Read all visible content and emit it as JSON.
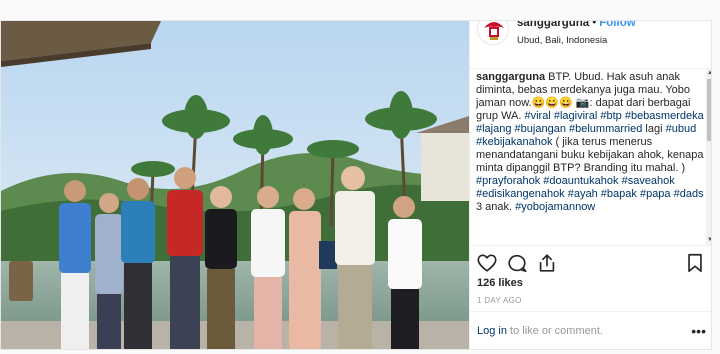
{
  "header": {
    "username": "sanggarguna",
    "separator": "•",
    "follow_label": "Follow",
    "location": "Ubud, Bali, Indonesia"
  },
  "caption": {
    "username": "sanggarguna",
    "text_1": " BTP. Ubud. Hak asuh anak diminta, bebas merdekanya juga mau. Yobo jaman now.",
    "emoji_1": "😀😀😀",
    "camera": "📷",
    "text_2": ": dapat dari berbagai grup WA. ",
    "tags_1": [
      "#viral",
      "#lagiviral",
      "#btp",
      "#bebasmerdeka",
      "#lajang",
      "#bujangan",
      "#belummarried"
    ],
    "text_3": " lagi ",
    "tags_2": [
      "#ubud",
      "#kebijakanahok"
    ],
    "text_4": " ( jika terus menerus menandatangani buku kebijakan ahok, kenapa minta dipanggil BTP? Branding itu mahal. ) ",
    "tags_3": [
      "#prayforahok",
      "#doauntukahok",
      "#saveahok",
      "#edisikangenahok",
      "#ayah",
      "#bapak",
      "#papa",
      "#dads"
    ],
    "text_5": " 3 anak. ",
    "tags_4": [
      "#yobojamannow"
    ]
  },
  "actions": {
    "like_icon": "heart-icon",
    "comment_icon": "comment-icon",
    "share_icon": "share-icon",
    "save_icon": "bookmark-icon"
  },
  "stats": {
    "likes": "126 likes",
    "time_ago": "1 DAY AGO"
  },
  "footer": {
    "login_link": "Log in",
    "login_rest": " to like or comment.",
    "more": "•••"
  },
  "colors": {
    "accent": "#3897f0",
    "hashtag": "#003569",
    "muted": "#999999"
  }
}
